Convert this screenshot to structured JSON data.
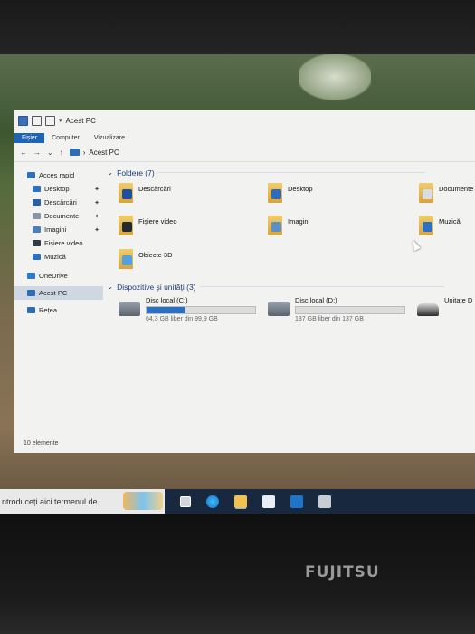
{
  "window": {
    "title": "Acest PC",
    "tabs": [
      "Fișier",
      "Computer",
      "Vizualizare"
    ],
    "address": "Acest PC",
    "status": "10 elemente"
  },
  "sidebar": {
    "items": [
      {
        "label": "Acces rapid",
        "icon": "star-icon",
        "color": "#2f6fc0"
      },
      {
        "label": "Desktop",
        "icon": "desktop-icon",
        "color": "#2f6fc0",
        "pinned": true
      },
      {
        "label": "Descărcări",
        "icon": "download-icon",
        "color": "#2a5fa8",
        "pinned": true
      },
      {
        "label": "Documente",
        "icon": "documents-icon",
        "color": "#8b96a3",
        "pinned": true
      },
      {
        "label": "Imagini",
        "icon": "pictures-icon",
        "color": "#4a7fb8",
        "pinned": true
      },
      {
        "label": "Fișiere video",
        "icon": "video-icon",
        "color": "#333a44"
      },
      {
        "label": "Muzică",
        "icon": "music-icon",
        "color": "#2f6fc0"
      },
      {
        "label": "OneDrive",
        "icon": "cloud-icon",
        "color": "#2f7ad0"
      },
      {
        "label": "Acest PC",
        "icon": "pc-icon",
        "color": "#2e6db5",
        "selected": true
      },
      {
        "label": "Rețea",
        "icon": "network-icon",
        "color": "#2e6db5"
      }
    ]
  },
  "main": {
    "folders_header": "Foldere (7)",
    "folders": [
      {
        "label": "Descărcări",
        "icon": "downloads-folder-icon",
        "badge": "#1f4fa0"
      },
      {
        "label": "Desktop",
        "icon": "desktop-folder-icon",
        "badge": "#2e6db5"
      },
      {
        "label": "Documente",
        "icon": "documents-folder-icon",
        "badge": "#d9dde3"
      },
      {
        "label": "Fișiere video",
        "icon": "videos-folder-icon",
        "badge": "#222a33"
      },
      {
        "label": "Imagini",
        "icon": "pictures-folder-icon",
        "badge": "#5c8fc4"
      },
      {
        "label": "Muzică",
        "icon": "music-folder-icon",
        "badge": "#2f6fc0"
      },
      {
        "label": "Obiecte 3D",
        "icon": "3d-objects-folder-icon",
        "badge": "#4fa3e0"
      }
    ],
    "drives_header": "Dispozitive și unități (3)",
    "drives": [
      {
        "label": "Disc local (C:)",
        "free": "64,3 GB liber din 99,9 GB",
        "used_fraction": 0.36
      },
      {
        "label": "Disc local (D:)",
        "free": "137 GB liber din 137 GB",
        "used_fraction": 0.0
      },
      {
        "label": "Unitate D",
        "free": "",
        "used_fraction": null
      }
    ]
  },
  "taskbar": {
    "search_placeholder": "ntroduceți aici termenul de",
    "icons": [
      "task-view-icon",
      "edge-icon",
      "file-explorer-icon",
      "store-icon",
      "outlook-icon",
      "app-icon"
    ]
  },
  "device": {
    "brand": "FUJITSU"
  },
  "colors": {
    "accent": "#1f63b4",
    "header_text": "#1a3e79",
    "taskbar": "#17283f"
  }
}
